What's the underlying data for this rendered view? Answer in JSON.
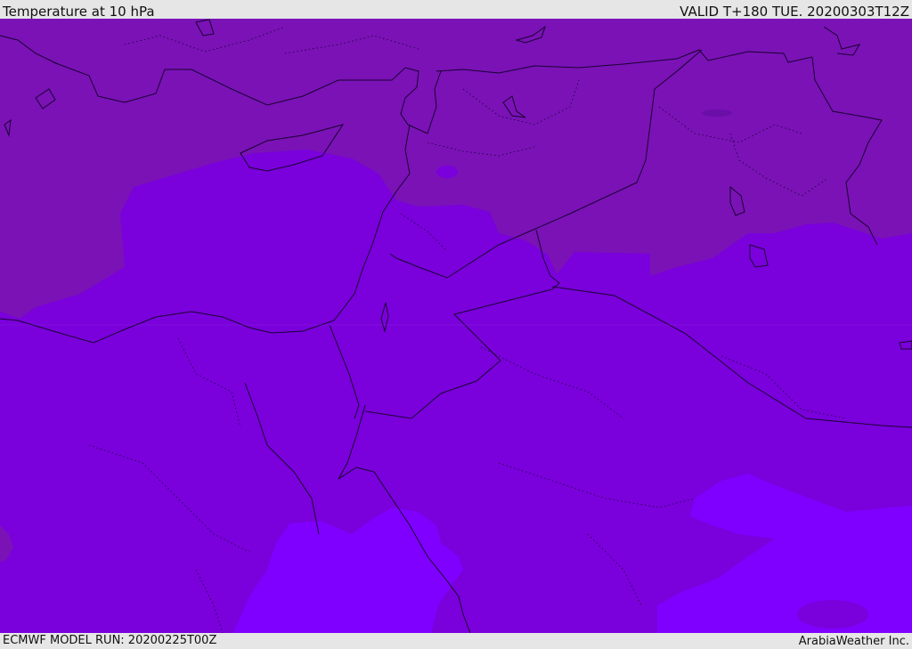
{
  "header": {
    "title": "Temperature at 10 hPa",
    "valid_time": "VALID T+180 TUE. 20200303T12Z"
  },
  "footer": {
    "model_run": "ECMWF MODEL RUN: 20200225T00Z",
    "credit": "ArabiaWeather Inc."
  },
  "colors": {
    "cold_band": "#7a12b6",
    "mid_band": "#7a00dc",
    "warm_band": "#7f00ff",
    "spot": "#6a0ea8",
    "coastline": "#1a0030",
    "border": "#1a0030"
  },
  "icons": {
    "map_background": "filled-contour-map"
  }
}
